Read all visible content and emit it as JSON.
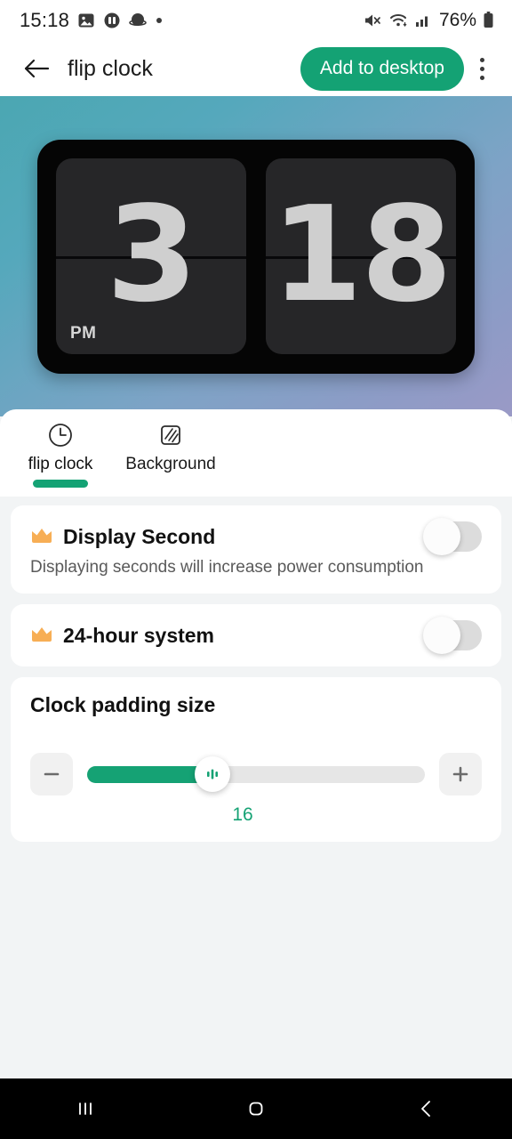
{
  "statusbar": {
    "time": "15:18",
    "battery_percent": "76%",
    "icons_left": [
      "image-icon",
      "app-badge-icon",
      "planet-icon",
      "dot-icon"
    ],
    "icons_right": [
      "mute-icon",
      "wifi-icon",
      "signal-icon",
      "battery-icon"
    ]
  },
  "appbar": {
    "back_icon": "arrow-left-icon",
    "title": "flip clock",
    "add_label": "Add to desktop",
    "overflow_icon": "more-vertical-icon",
    "accent": "#14A274"
  },
  "preview": {
    "hour": "3",
    "minute": "18",
    "meridiem": "PM",
    "gradient_from": "#4BA7B2",
    "gradient_to": "#9A9AC6"
  },
  "tabs": [
    {
      "label": "flip clock",
      "icon": "clock-icon",
      "active": true
    },
    {
      "label": "Background",
      "icon": "pattern-square-icon",
      "active": false
    }
  ],
  "settings": [
    {
      "id": "display-second",
      "title": "Display Second",
      "subtitle": "Displaying seconds will increase power consumption",
      "premium_icon": "crown-icon",
      "toggle_on": false
    },
    {
      "id": "24-hour-system",
      "title": "24-hour system",
      "subtitle": "",
      "premium_icon": "crown-icon",
      "toggle_on": false
    }
  ],
  "padding": {
    "title": "Clock padding size",
    "value": "16",
    "minus_icon": "minus-icon",
    "plus_icon": "plus-icon",
    "thumb_icon": "slider-bars-icon",
    "fill_color": "#15A274"
  },
  "navbar": {
    "recents_icon": "recents-icon",
    "home_icon": "home-icon",
    "back_icon": "back-chevron-icon"
  }
}
